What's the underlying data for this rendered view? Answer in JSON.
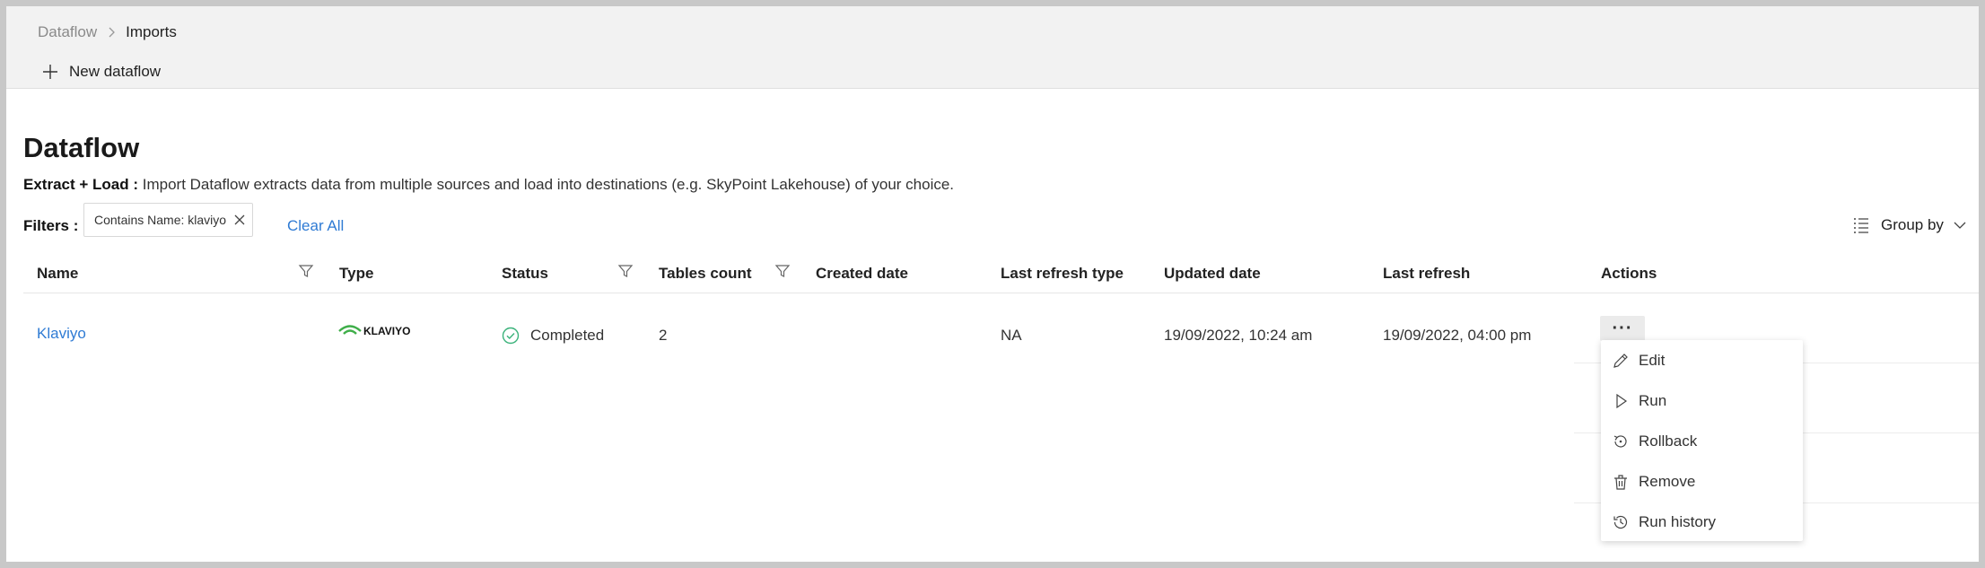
{
  "breadcrumb": {
    "root": "Dataflow",
    "current": "Imports"
  },
  "toolbar": {
    "new_label": "New dataflow"
  },
  "page": {
    "title": "Dataflow",
    "description_bold": "Extract + Load :",
    "description_text": " Import Dataflow extracts data from multiple sources and load into destinations (e.g. SkyPoint Lakehouse) of your choice."
  },
  "filters": {
    "label": "Filters :",
    "chip": "Contains Name: klaviyo",
    "clear_all": "Clear All"
  },
  "group_by": {
    "label": "Group by"
  },
  "table": {
    "columns": {
      "name": "Name",
      "type": "Type",
      "status": "Status",
      "tables_count": "Tables count",
      "created_date": "Created date",
      "last_refresh_type": "Last refresh type",
      "updated_date": "Updated date",
      "last_refresh": "Last refresh",
      "actions": "Actions"
    },
    "rows": [
      {
        "name": "Klaviyo",
        "type_logo": "KLAVIYO",
        "status": "Completed",
        "tables_count": "2",
        "created_date": "",
        "last_refresh_type": "NA",
        "updated_date": "19/09/2022, 10:24 am",
        "last_refresh": "19/09/2022, 04:00 pm",
        "actions_label": "···"
      }
    ]
  },
  "actions_menu": {
    "items": [
      {
        "label": "Edit",
        "icon": "pencil-icon"
      },
      {
        "label": "Run",
        "icon": "play-icon"
      },
      {
        "label": "Rollback",
        "icon": "rollback-icon"
      },
      {
        "label": "Remove",
        "icon": "trash-icon"
      },
      {
        "label": "Run history",
        "icon": "history-icon"
      }
    ]
  },
  "colors": {
    "link": "#2f7bd4",
    "status_completed": "#3ab27a",
    "klaviyo_green": "#3fae49"
  }
}
